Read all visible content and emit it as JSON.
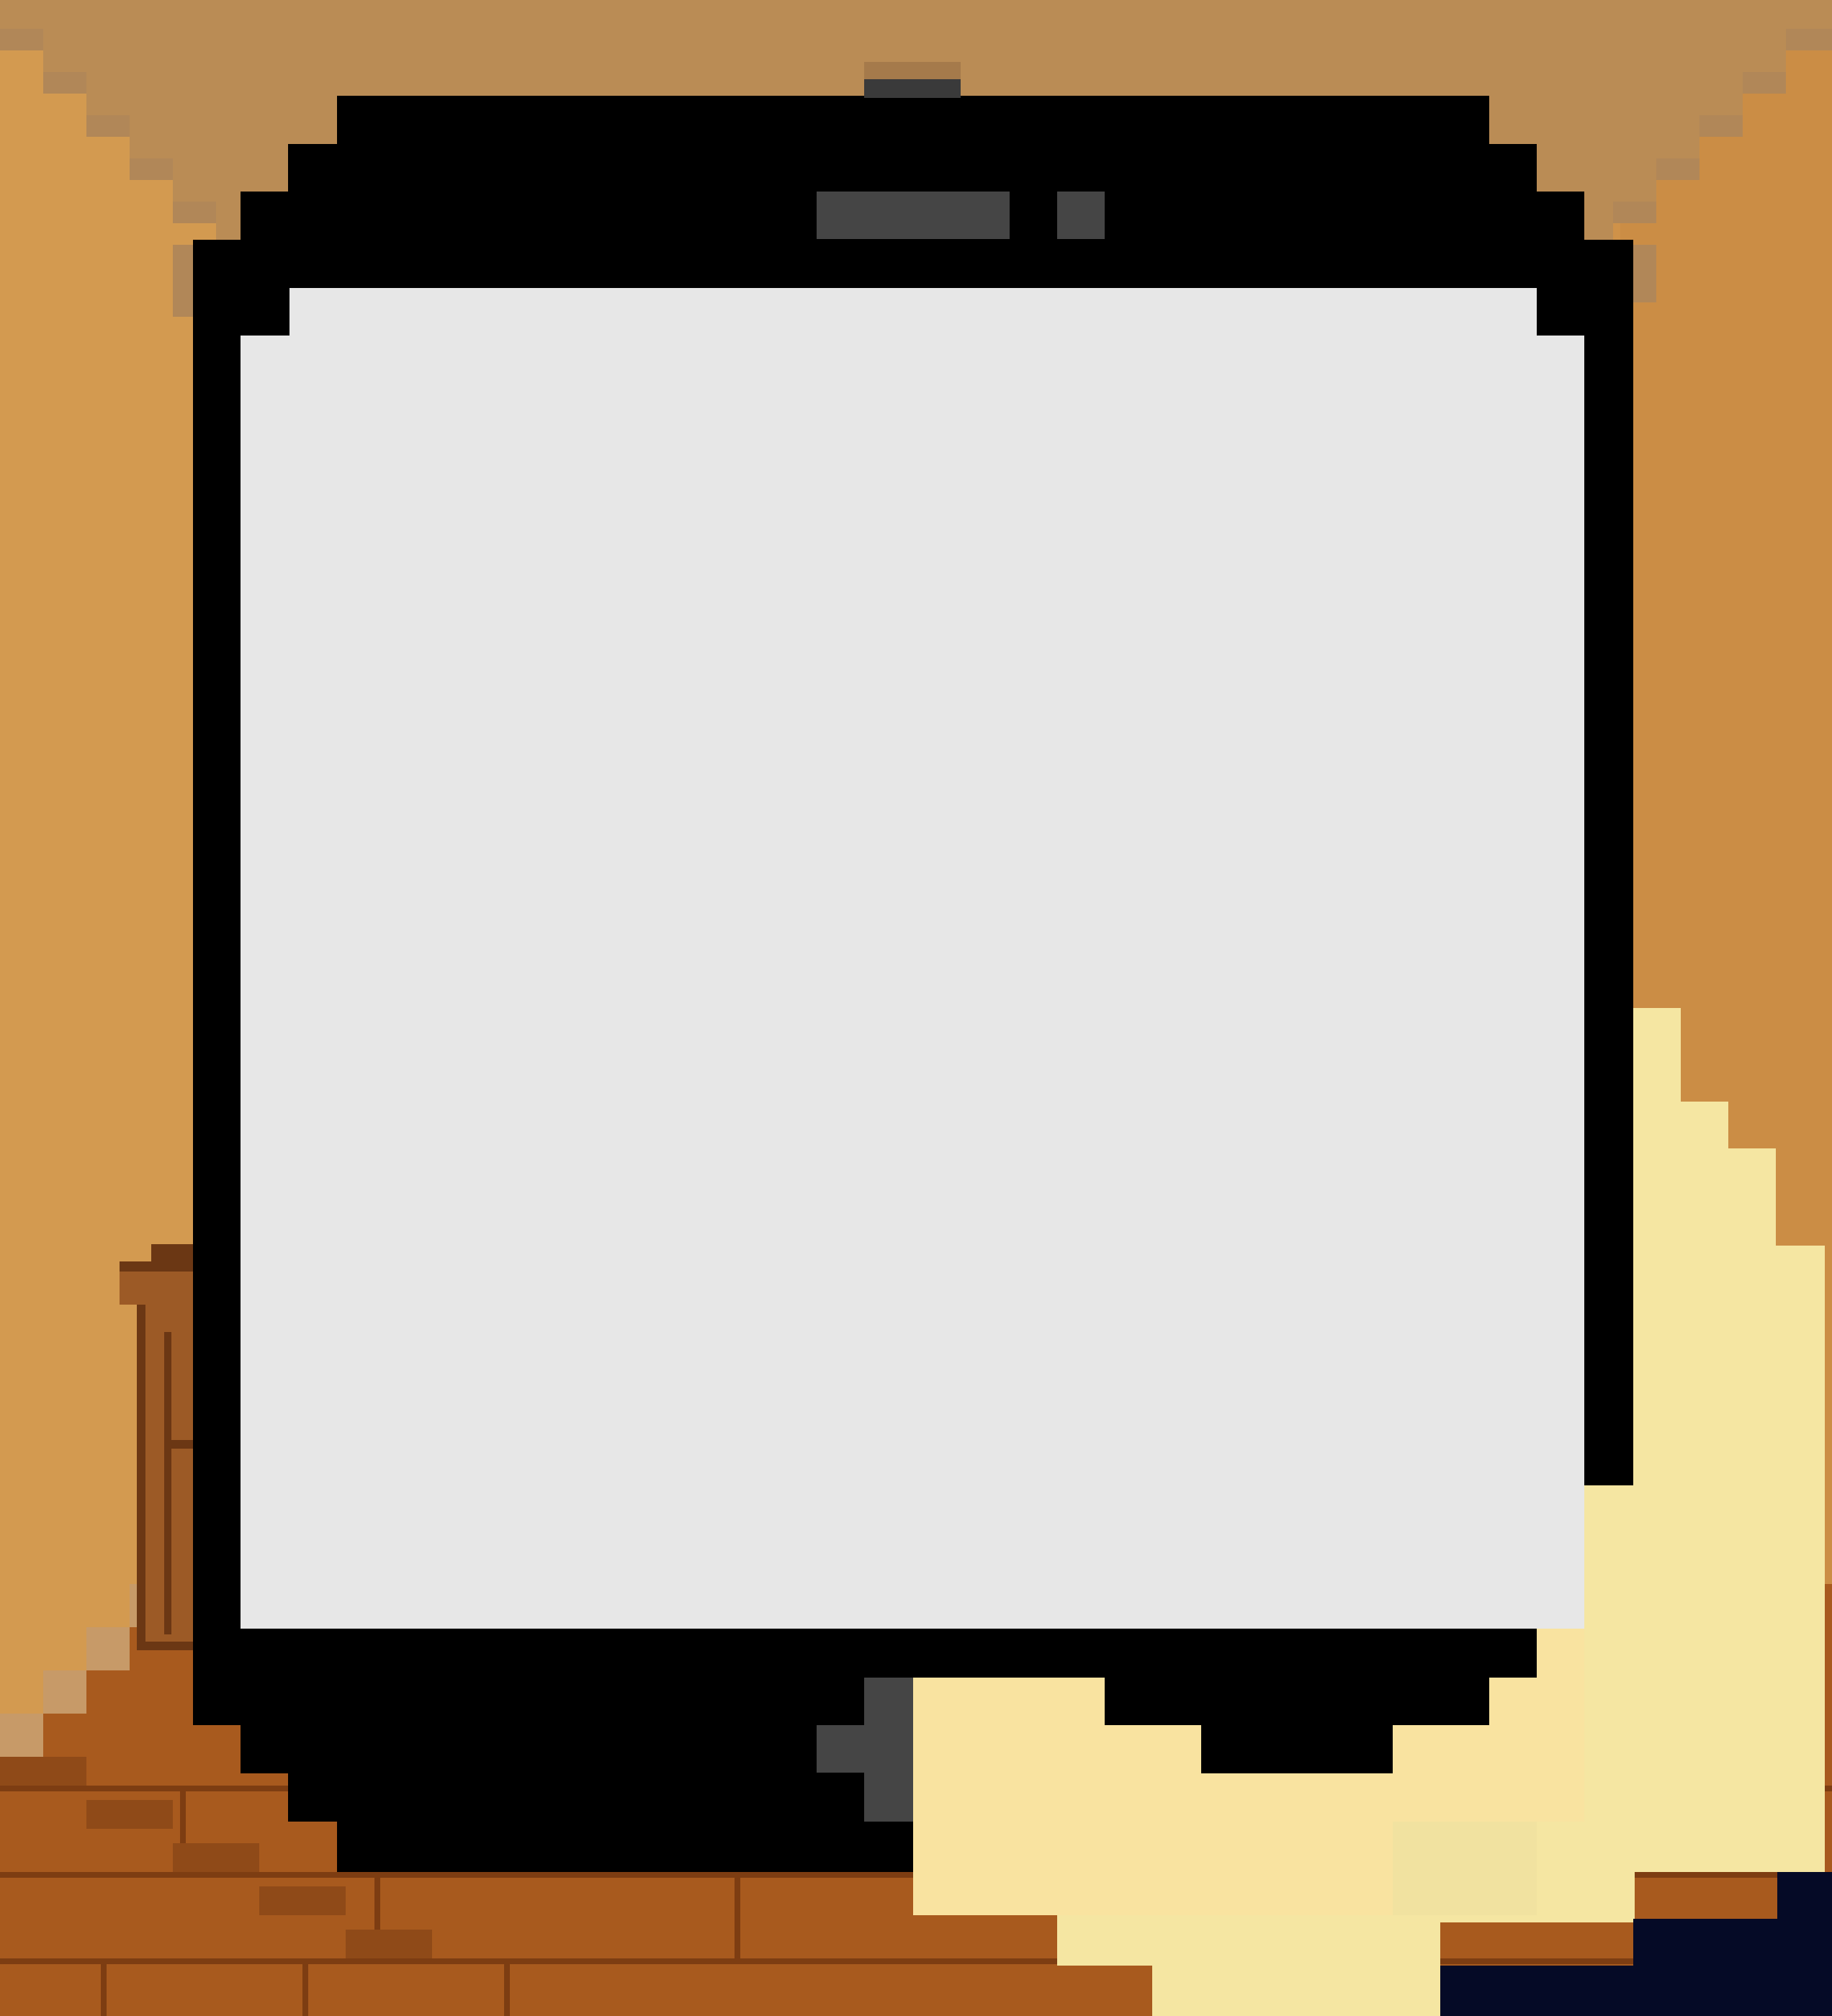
{
  "scene": {
    "kind": "pixel-art room with handheld phone",
    "colors": {
      "wall": "#cf9249",
      "wall_light": "#d99f55",
      "ceiling": "#ba8c55",
      "wall_edge": "#b18758",
      "floor": "#a85a1e",
      "floor_dark": "#8f4a18",
      "floor_line": "#7d3d12",
      "furniture": "#9c5a26",
      "furniture_dark": "#6b3714",
      "phone_body": "#000000",
      "phone_screen": "#e7e7e7",
      "phone_detail": "#454545",
      "hand": "#f5e6a2",
      "hand_shade": "#f9e3a0",
      "sleeve": "#050a26"
    }
  },
  "phone": {
    "screen_content": ""
  },
  "icons": {
    "speaker": "speaker-slot-icon",
    "camera": "front-camera-icon",
    "home_button": "home-button-icon"
  }
}
